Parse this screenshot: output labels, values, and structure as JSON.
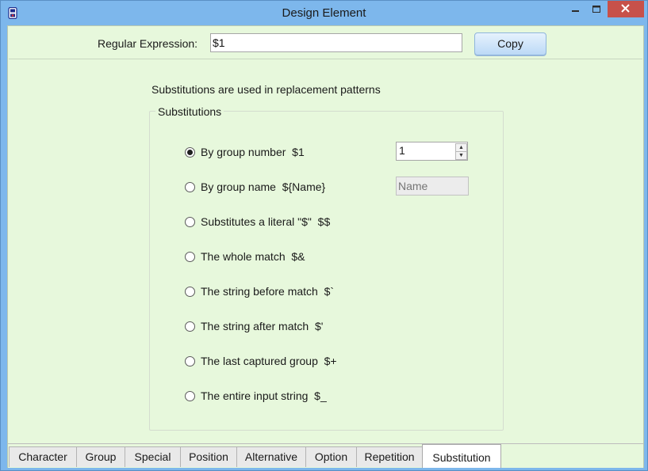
{
  "window": {
    "title": "Design Element",
    "icon": "app-icon",
    "controls": [
      "minimize-icon",
      "maximize-icon",
      "close-icon"
    ]
  },
  "regex": {
    "label": "Regular Expression:",
    "value": "$1",
    "copy_label": "Copy"
  },
  "panel": {
    "description": "Substitutions are used in replacement patterns",
    "group_title": "Substitutions",
    "options": [
      {
        "label": "By group number  $1",
        "selected": true
      },
      {
        "label": "By group name  ${Name}",
        "selected": false
      },
      {
        "label": "Substitutes a literal \"$\"  $$",
        "selected": false
      },
      {
        "label": "The whole match  $&",
        "selected": false
      },
      {
        "label": "The string before match  $`",
        "selected": false
      },
      {
        "label": "The string after match  $'",
        "selected": false
      },
      {
        "label": "The last captured group  $+",
        "selected": false
      },
      {
        "label": "The entire input string  $_",
        "selected": false
      }
    ],
    "group_number_value": "1",
    "group_name_placeholder": "Name"
  },
  "tabs": [
    {
      "label": "Character"
    },
    {
      "label": "Group"
    },
    {
      "label": "Special"
    },
    {
      "label": "Position"
    },
    {
      "label": "Alternative"
    },
    {
      "label": "Option"
    },
    {
      "label": "Repetition"
    },
    {
      "label": "Substitution",
      "active": true
    }
  ],
  "colors": {
    "titlebar": "#7db7ec",
    "client_bg": "#e7f8dc",
    "close_button": "#c7514a",
    "copy_button": "#bcd9f6"
  }
}
